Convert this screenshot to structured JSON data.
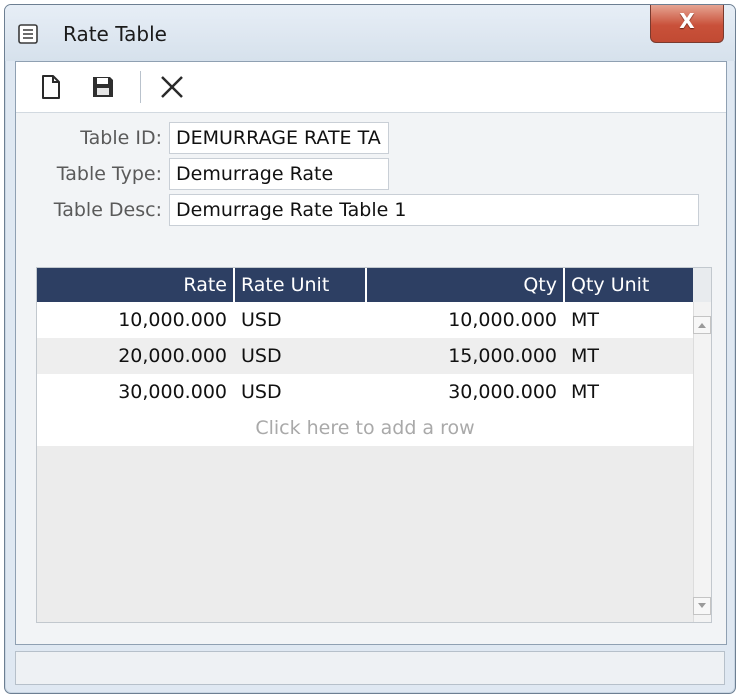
{
  "window": {
    "title": "Rate Table",
    "close_label": "X"
  },
  "toolbar": {
    "new_icon": "new-document-icon",
    "save_icon": "save-icon",
    "delete_icon": "delete-icon"
  },
  "form": {
    "table_id": {
      "label": "Table ID:",
      "value": "DEMURRAGE RATE TA"
    },
    "table_type": {
      "label": "Table Type:",
      "value": "Demurrage Rate"
    },
    "table_desc": {
      "label": "Table Desc:",
      "value": "Demurrage Rate Table 1"
    }
  },
  "grid": {
    "columns": [
      "Rate",
      "Rate Unit",
      "Qty",
      "Qty Unit"
    ],
    "rows": [
      {
        "rate": "10,000.000",
        "rate_unit": "USD",
        "qty": "10,000.000",
        "qty_unit": "MT"
      },
      {
        "rate": "20,000.000",
        "rate_unit": "USD",
        "qty": "15,000.000",
        "qty_unit": "MT"
      },
      {
        "rate": "30,000.000",
        "rate_unit": "USD",
        "qty": "30,000.000",
        "qty_unit": "MT"
      }
    ],
    "add_row_text": "Click here to add a row"
  },
  "colors": {
    "header_bg": "#2d3f63",
    "close_button": "#c9513a",
    "alt_row": "#eeeeee"
  }
}
